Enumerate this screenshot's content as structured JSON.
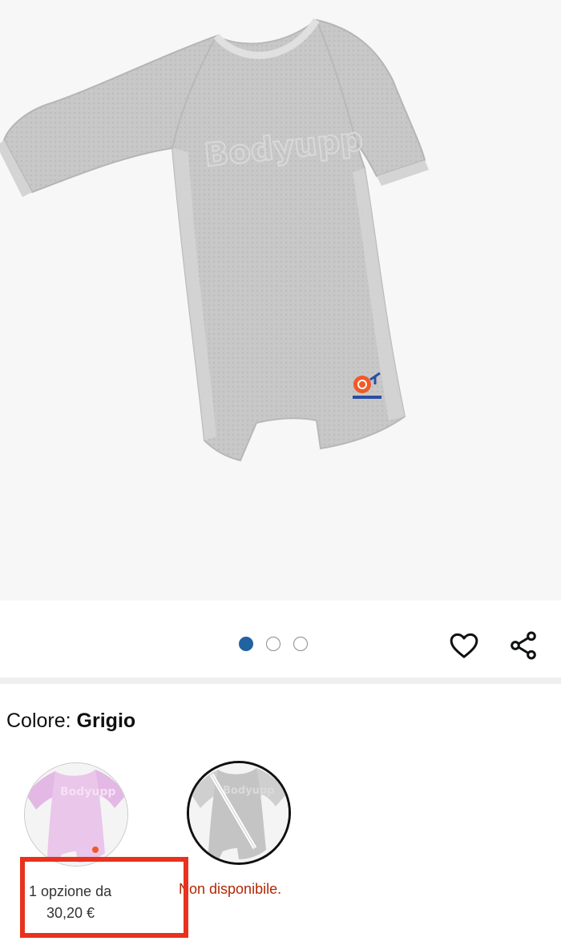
{
  "product": {
    "image_icon": "baby-romper-grey-image"
  },
  "carousel": {
    "total_images": 3,
    "active_index": 0,
    "active_color": "#2162a1"
  },
  "actions": {
    "wishlist_icon": "heart-icon",
    "share_icon": "share-icon"
  },
  "color_selector": {
    "label": "Colore: ",
    "selected_value": "Grigio",
    "options": [
      {
        "name": "Rosa",
        "swatch_icon": "pink-romper-swatch",
        "line1": "1 opzione da",
        "price": "30,20 €",
        "color": "#e9c6ea"
      },
      {
        "name": "Grigio",
        "swatch_icon": "grey-romper-swatch",
        "status": "Non disponibile.",
        "status_color": "#b12704"
      }
    ]
  },
  "highlight_color": "#e8321e"
}
